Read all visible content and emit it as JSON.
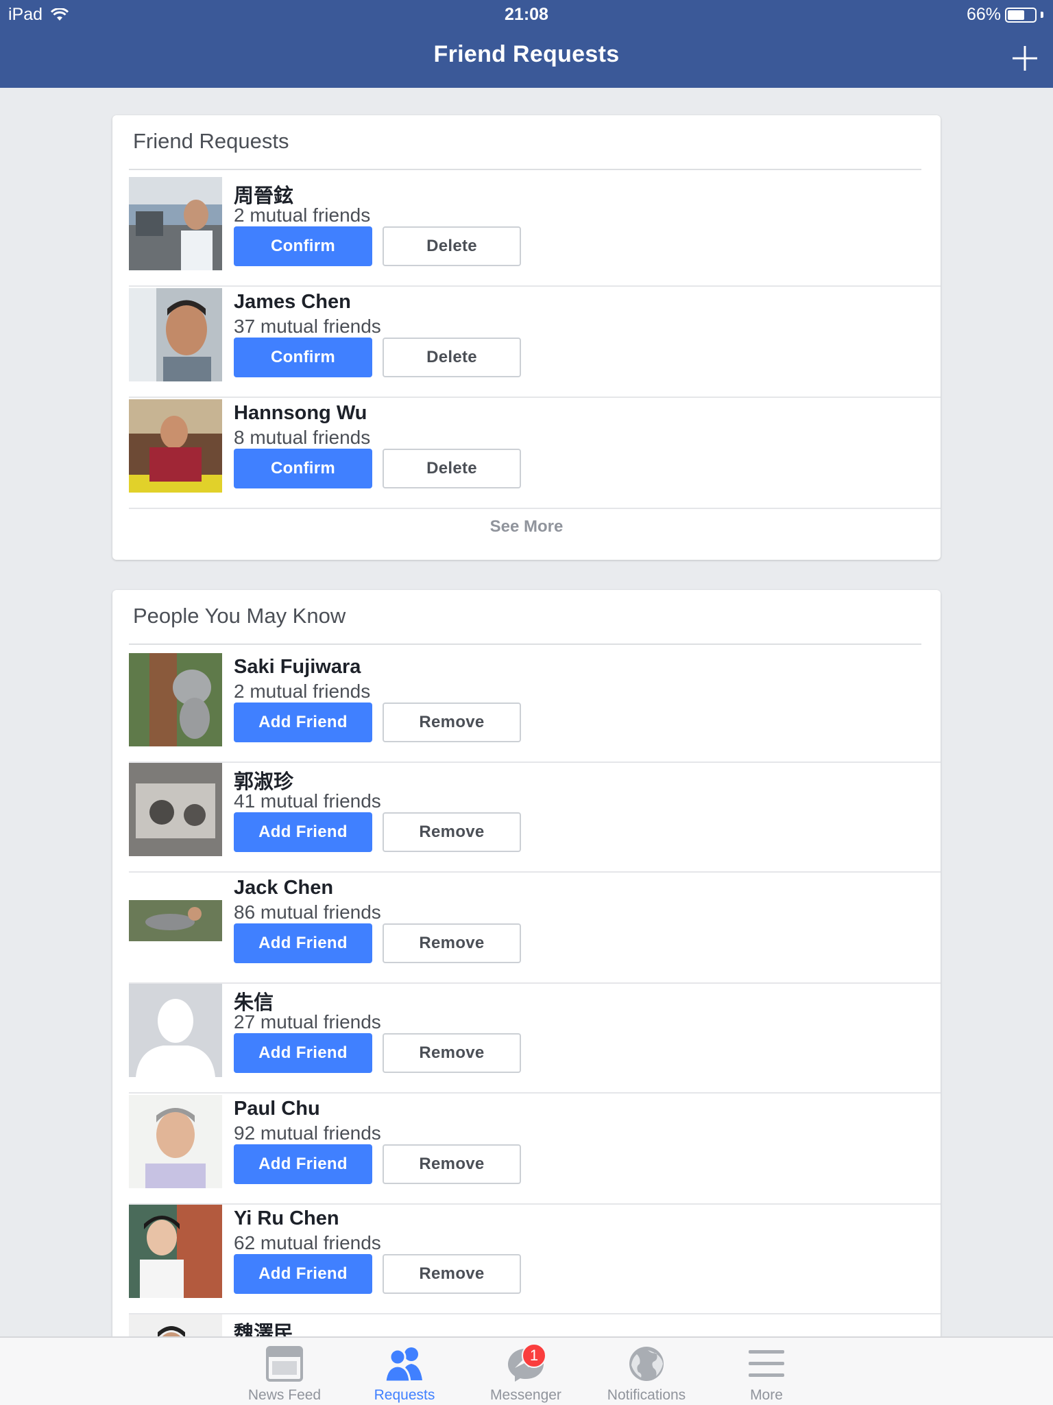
{
  "status_bar": {
    "device": "iPad",
    "time": "21:08",
    "battery": "66%",
    "battery_level": 0.66
  },
  "nav": {
    "title": "Friend Requests",
    "add_icon": "plus-icon"
  },
  "friend_requests": {
    "title": "Friend Requests",
    "items": [
      {
        "name": "周晉鉉",
        "mutual": "2 mutual friends",
        "confirm": "Confirm",
        "delete": "Delete"
      },
      {
        "name": "James Chen",
        "mutual": "37 mutual friends",
        "confirm": "Confirm",
        "delete": "Delete"
      },
      {
        "name": "Hannsong Wu",
        "mutual": "8 mutual friends",
        "confirm": "Confirm",
        "delete": "Delete"
      }
    ],
    "see_more": "See More"
  },
  "people_you_may_know": {
    "title": "People You May Know",
    "items": [
      {
        "name": "Saki Fujiwara",
        "mutual": "2 mutual friends",
        "add": "Add Friend",
        "remove": "Remove"
      },
      {
        "name": "郭淑珍",
        "mutual": "41 mutual friends",
        "add": "Add Friend",
        "remove": "Remove"
      },
      {
        "name": "Jack Chen",
        "mutual": "86 mutual friends",
        "add": "Add Friend",
        "remove": "Remove"
      },
      {
        "name": "朱信",
        "mutual": "27 mutual friends",
        "add": "Add Friend",
        "remove": "Remove"
      },
      {
        "name": "Paul Chu",
        "mutual": "92 mutual friends",
        "add": "Add Friend",
        "remove": "Remove"
      },
      {
        "name": "Yi Ru Chen",
        "mutual": "62 mutual friends",
        "add": "Add Friend",
        "remove": "Remove"
      },
      {
        "name": "魏澤民"
      }
    ]
  },
  "tabbar": {
    "tabs": [
      {
        "label": "News Feed",
        "icon": "news-feed-icon"
      },
      {
        "label": "Requests",
        "icon": "requests-icon",
        "active": true
      },
      {
        "label": "Messenger",
        "icon": "messenger-icon",
        "badge": "1"
      },
      {
        "label": "Notifications",
        "icon": "globe-icon"
      },
      {
        "label": "More",
        "icon": "menu-icon"
      }
    ]
  },
  "colors": {
    "nav_bg": "#3b5998",
    "page_bg": "#e9ebee",
    "primary_button": "#4080ff",
    "badge": "#fa3e3e"
  }
}
